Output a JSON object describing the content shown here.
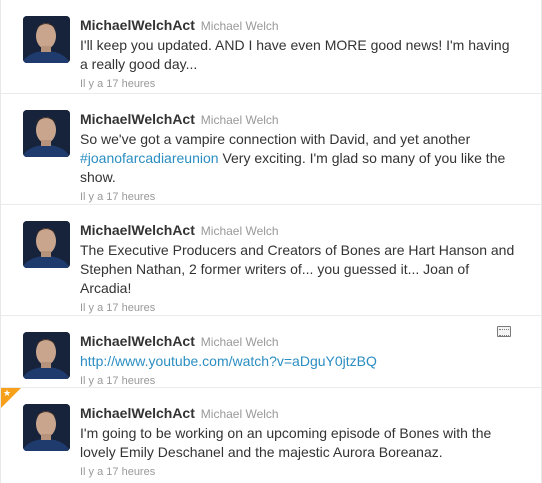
{
  "tweets": [
    {
      "screen_name": "MichaelWelchAct",
      "full_name": "Michael Welch",
      "text": "I'll keep you updated. AND I have even MORE good news! I'm having a really good day...",
      "timestamp": "Il y a 17 heures"
    },
    {
      "screen_name": "MichaelWelchAct",
      "full_name": "Michael Welch",
      "text_before": "So we've got a vampire connection with David, and yet another ",
      "hashtag": "#joanofarcadiareunion",
      "text_after": " Very exciting. I'm glad so many of you like the show.",
      "timestamp": "Il y a 17 heures"
    },
    {
      "screen_name": "MichaelWelchAct",
      "full_name": "Michael Welch",
      "text": "The Executive Producers and Creators of Bones are Hart Hanson and Stephen Nathan, 2 former writers of... you guessed it... Joan of Arcadia!",
      "timestamp": "Il y a 17 heures"
    },
    {
      "screen_name": "MichaelWelchAct",
      "full_name": "Michael Welch",
      "link": "http://www.youtube.com/watch?v=aDguY0jtzBQ",
      "timestamp": "Il y a 17 heures",
      "media_icon": "media-card-icon"
    },
    {
      "screen_name": "MichaelWelchAct",
      "full_name": "Michael Welch",
      "text": "I'm going to be working on an upcoming episode of Bones with the lovely Emily Deschanel and the majestic Aurora Boreanaz.",
      "timestamp": "Il y a 17 heures",
      "favorited": true,
      "favorite_icon": "star-icon"
    }
  ],
  "colors": {
    "link": "#2b8ec2",
    "muted": "#999999",
    "text": "#333333",
    "favorite": "#f6a01b"
  }
}
